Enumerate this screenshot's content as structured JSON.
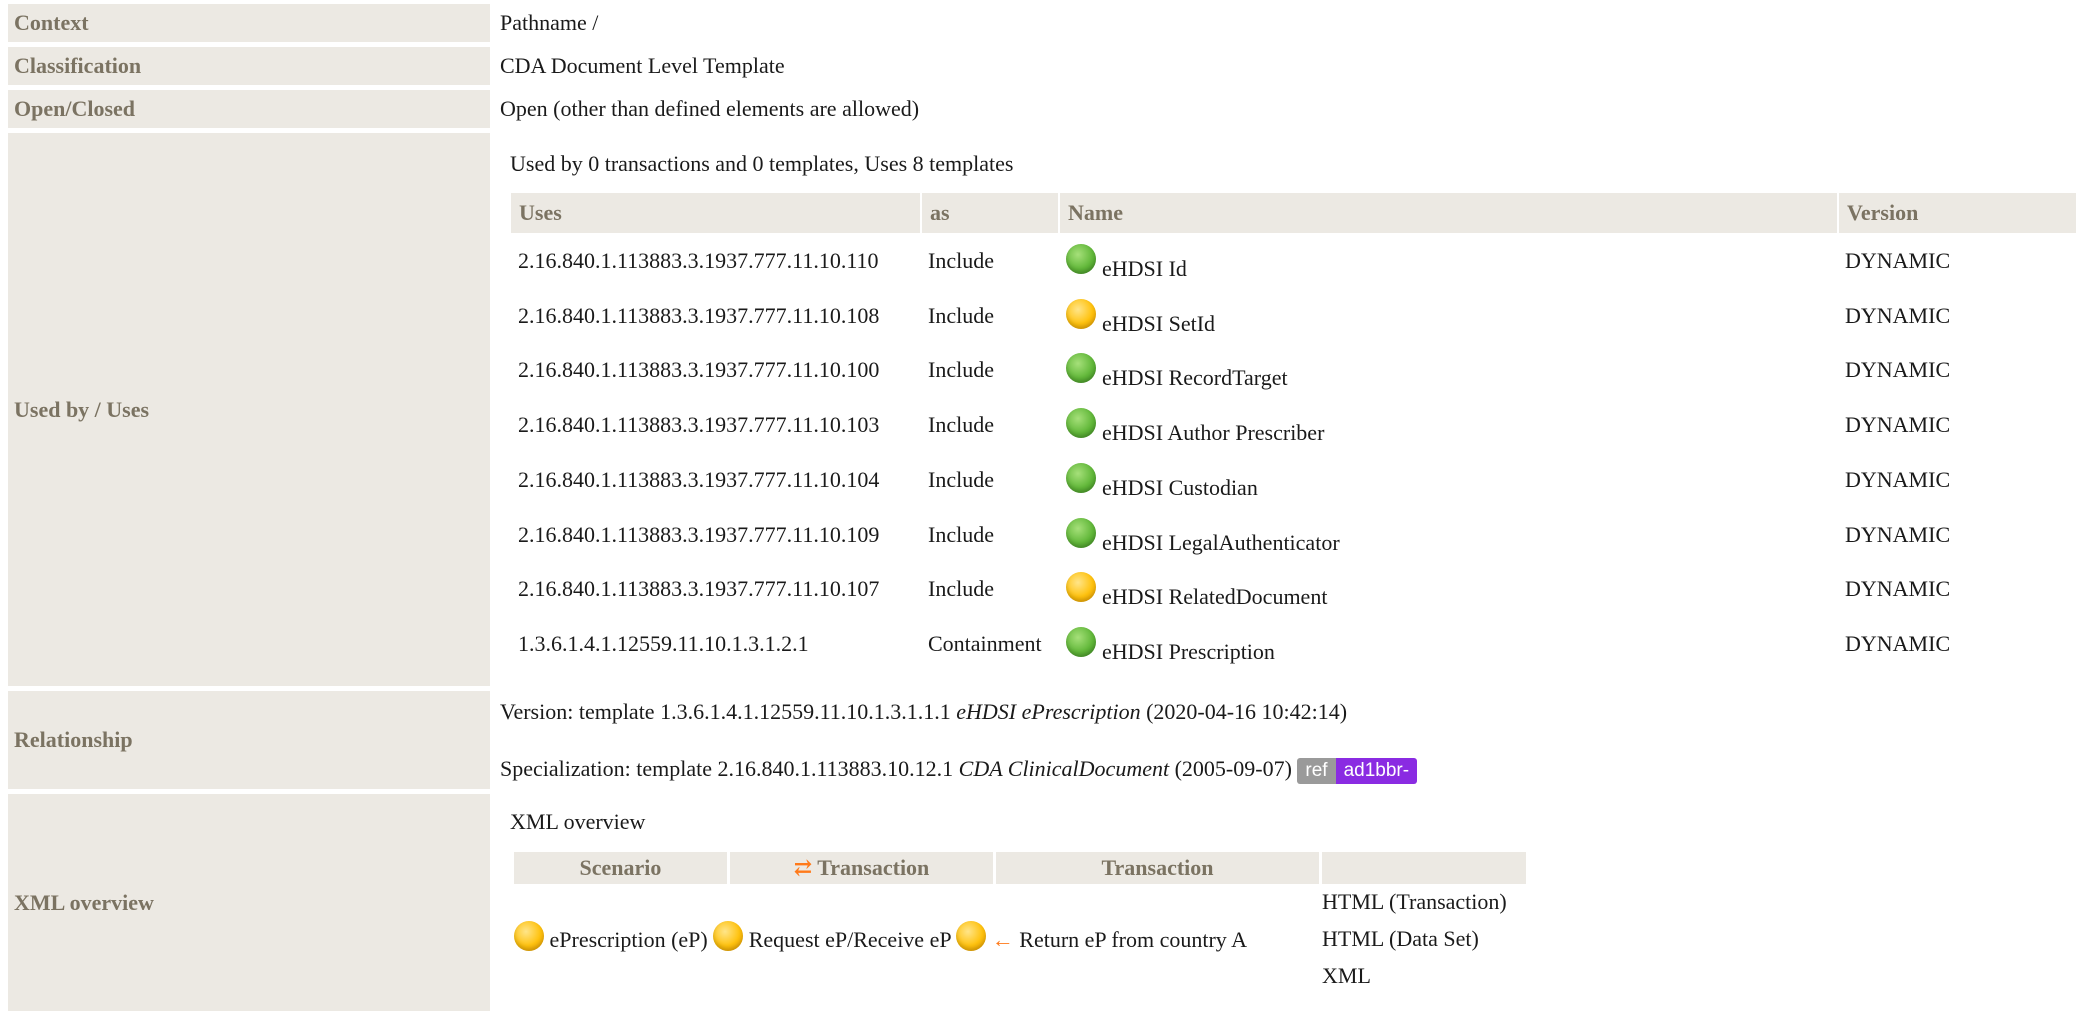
{
  "rows": {
    "context": {
      "label": "Context",
      "value": "Pathname /"
    },
    "classification": {
      "label": "Classification",
      "value": "CDA Document Level Template"
    },
    "open_closed": {
      "label": "Open/Closed",
      "value": "Open (other than defined elements are allowed)"
    },
    "used_by": {
      "label": "Used by / Uses",
      "summary": "Used by 0 transactions and 0 templates, Uses 8 templates",
      "headers": {
        "uses": "Uses",
        "as": "as",
        "name": "Name",
        "version": "Version"
      },
      "items": [
        {
          "uses": "2.16.840.1.113883.3.1937.777.11.10.110",
          "as": "Include",
          "status": "green",
          "name": "eHDSI Id",
          "version": "DYNAMIC"
        },
        {
          "uses": "2.16.840.1.113883.3.1937.777.11.10.108",
          "as": "Include",
          "status": "yellow",
          "name": "eHDSI SetId",
          "version": "DYNAMIC"
        },
        {
          "uses": "2.16.840.1.113883.3.1937.777.11.10.100",
          "as": "Include",
          "status": "green",
          "name": "eHDSI RecordTarget",
          "version": "DYNAMIC"
        },
        {
          "uses": "2.16.840.1.113883.3.1937.777.11.10.103",
          "as": "Include",
          "status": "green",
          "name": "eHDSI Author Prescriber",
          "version": "DYNAMIC"
        },
        {
          "uses": "2.16.840.1.113883.3.1937.777.11.10.104",
          "as": "Include",
          "status": "green",
          "name": "eHDSI Custodian",
          "version": "DYNAMIC"
        },
        {
          "uses": "2.16.840.1.113883.3.1937.777.11.10.109",
          "as": "Include",
          "status": "green",
          "name": "eHDSI LegalAuthenticator",
          "version": "DYNAMIC"
        },
        {
          "uses": "2.16.840.1.113883.3.1937.777.11.10.107",
          "as": "Include",
          "status": "yellow",
          "name": "eHDSI RelatedDocument",
          "version": "DYNAMIC"
        },
        {
          "uses": "1.3.6.1.4.1.12559.11.10.1.3.1.2.1",
          "as": "Containment",
          "status": "green",
          "name": "eHDSI Prescription",
          "version": "DYNAMIC"
        }
      ]
    },
    "relationship": {
      "label": "Relationship",
      "version_prefix": "Version: template 1.3.6.1.4.1.12559.11.10.1.3.1.1.1",
      "version_name": "eHDSI ePrescription",
      "version_date": "(2020-04-16 10:42:14)",
      "spec_prefix": "Specialization: template 2.16.840.1.113883.10.12.1",
      "spec_name": "CDA ClinicalDocument",
      "spec_date": "(2005-09-07)",
      "badge_ref": "ref",
      "badge_id": "ad1bbr-"
    },
    "xml_overview": {
      "label": "XML overview",
      "caption": "XML overview",
      "headers": {
        "scenario": "Scenario",
        "transaction1": "Transaction",
        "transaction2": "Transaction"
      },
      "scenario": "ePrescription (eP)",
      "transaction1": "Request eP/Receive eP",
      "transaction2": "Return eP from country A",
      "links": [
        "HTML (Transaction)",
        "HTML (Data Set)",
        "XML"
      ]
    }
  },
  "colors": {
    "label_bg": "#ece9e3",
    "label_text": "#7b7362",
    "green": "#62b83a",
    "yellow": "#ffc20e",
    "orange": "#ff7a1a",
    "badge_id": "#8a2be2"
  }
}
